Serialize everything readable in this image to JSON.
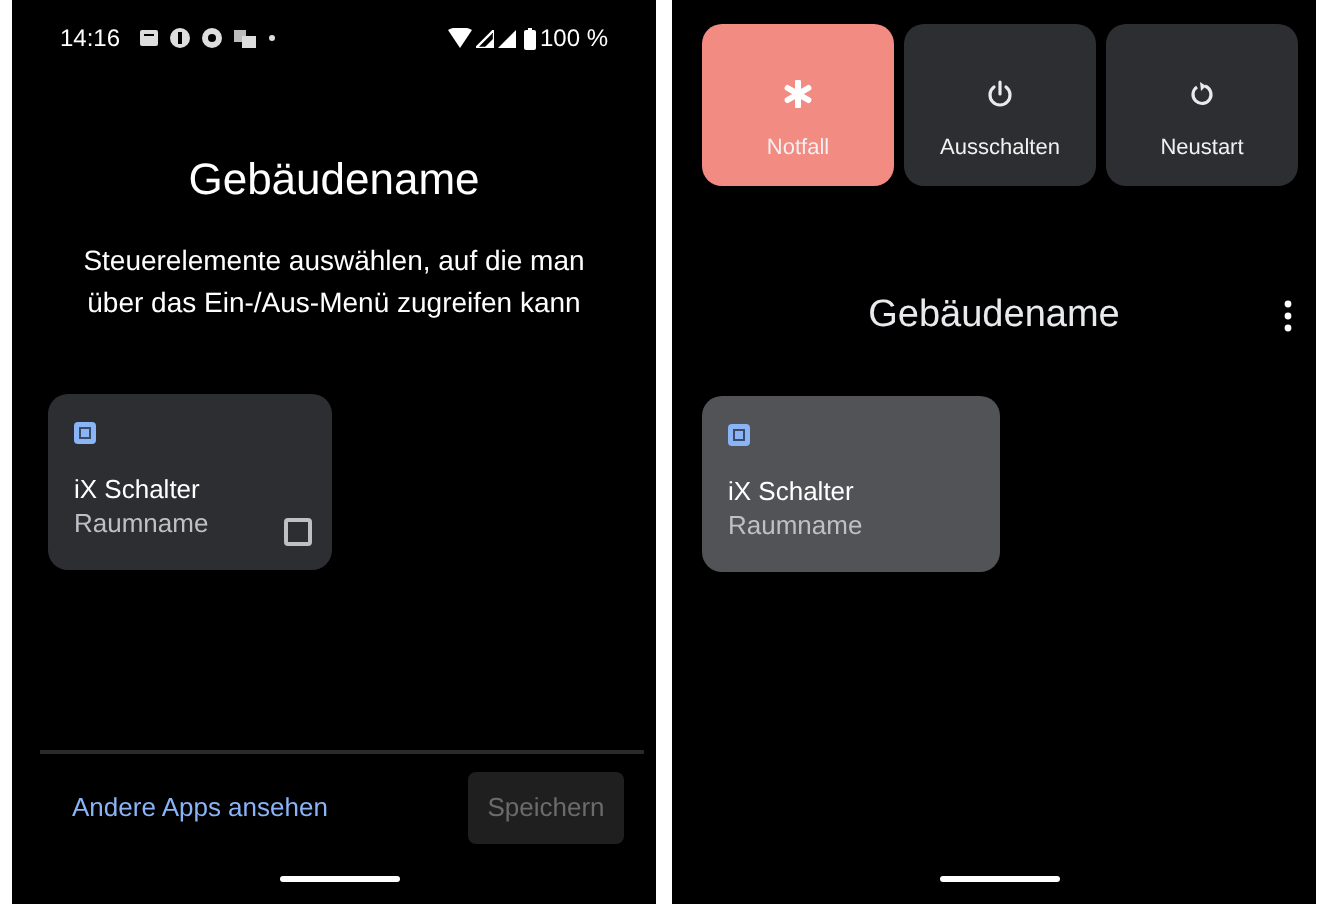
{
  "left": {
    "status_bar": {
      "time": "14:16",
      "battery": "100 %"
    },
    "title": "Gebäudename",
    "subtitle": "Steuerelemente auswählen, auf die man über das Ein-/Aus-Menü zugreifen kann",
    "controls": [
      {
        "title": "iX Schalter",
        "room": "Raumname",
        "checked": false
      }
    ],
    "footer": {
      "link": "Andere Apps ansehen",
      "save_button": {
        "label": "Speichern",
        "disabled": true
      }
    }
  },
  "right": {
    "power_buttons": [
      {
        "label": "Notfall",
        "kind": "emergency"
      },
      {
        "label": "Ausschalten",
        "kind": "power"
      },
      {
        "label": "Neustart",
        "kind": "restart"
      }
    ],
    "title": "Gebäudename",
    "controls": [
      {
        "title": "iX Schalter",
        "room": "Raumname"
      }
    ]
  }
}
